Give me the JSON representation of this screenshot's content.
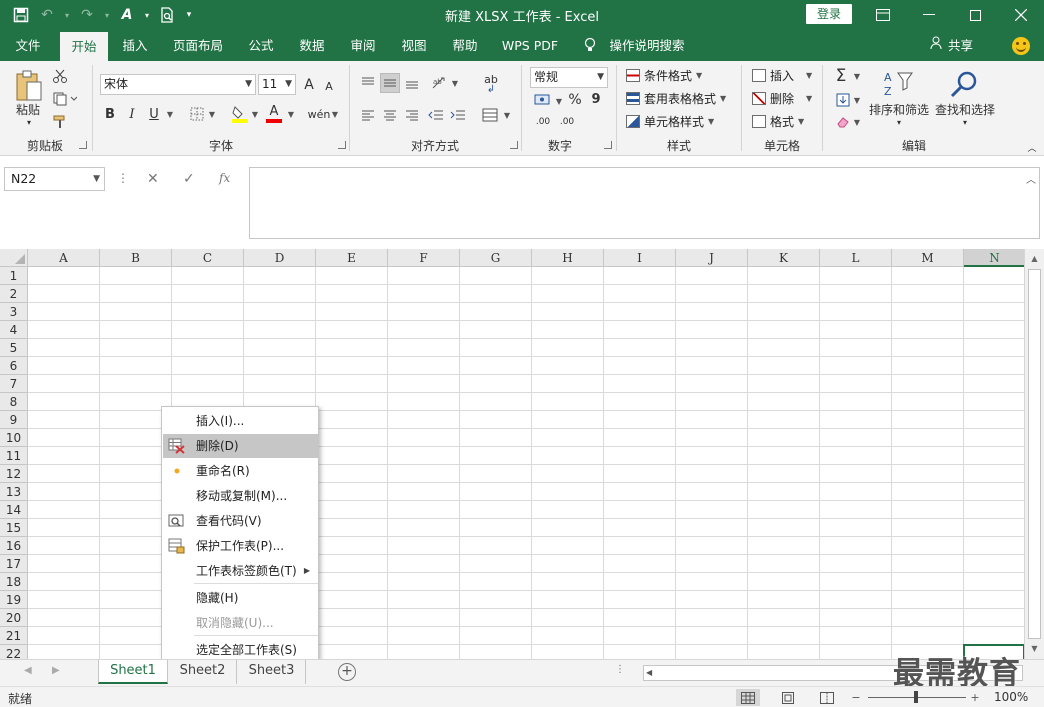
{
  "title": "新建 XLSX 工作表 - Excel",
  "login": "登录",
  "colors": {
    "brand": "#217346",
    "menu_hover": "#c6c6c6"
  },
  "tabs": [
    "文件",
    "开始",
    "插入",
    "页面布局",
    "公式",
    "数据",
    "审阅",
    "视图",
    "帮助",
    "WPS PDF",
    "操作说明搜索"
  ],
  "share": "共享",
  "ribbon": {
    "clipboard": {
      "paste": "粘贴",
      "label": "剪贴板"
    },
    "font": {
      "name": "宋体",
      "size": "11",
      "bold": "B",
      "italic": "I",
      "underline": "U",
      "grow": "A",
      "shrink": "A",
      "font_color": "A",
      "phonetic": "wén",
      "label": "字体"
    },
    "alignment": {
      "label": "对齐方式",
      "wrap": "ab"
    },
    "number": {
      "format": "常规",
      "percent": "%",
      "comma": "9",
      "inc": ".00",
      "dec": ".00",
      "label": "数字"
    },
    "styles": {
      "cond": "条件格式",
      "table": "套用表格格式",
      "cell": "单元格样式",
      "label": "样式"
    },
    "cells": {
      "insert": "插入",
      "delete": "删除",
      "format": "格式",
      "label": "单元格"
    },
    "editing": {
      "sort": "排序和筛选",
      "find": "查找和选择",
      "label": "编辑",
      "sigma": "Σ"
    }
  },
  "formula_bar": {
    "name_box": "N22",
    "fx": "fx",
    "value": ""
  },
  "columns": [
    "A",
    "B",
    "C",
    "D",
    "E",
    "F",
    "G",
    "H",
    "I",
    "J",
    "K",
    "L",
    "M",
    "N"
  ],
  "rows": [
    "1",
    "2",
    "3",
    "4",
    "5",
    "6",
    "7",
    "8",
    "9",
    "10",
    "11",
    "12",
    "13",
    "14",
    "15",
    "16",
    "17",
    "18",
    "19",
    "20",
    "21",
    "22"
  ],
  "selected_column": "N",
  "selected_cell": "N22",
  "context_menu": [
    {
      "label": "插入(I)...",
      "icon": "",
      "state": "normal"
    },
    {
      "label": "删除(D)",
      "icon": "delete-sheet-icon",
      "state": "hover"
    },
    {
      "label": "重命名(R)",
      "icon": "dot-icon",
      "state": "normal"
    },
    {
      "label": "移动或复制(M)...",
      "icon": "",
      "state": "normal"
    },
    {
      "label": "查看代码(V)",
      "icon": "view-code-icon",
      "state": "normal"
    },
    {
      "label": "保护工作表(P)...",
      "icon": "protect-sheet-icon",
      "state": "normal"
    },
    {
      "label": "工作表标签颜色(T)",
      "icon": "",
      "state": "normal",
      "submenu": true
    },
    {
      "label": "隐藏(H)",
      "icon": "",
      "state": "normal"
    },
    {
      "label": "取消隐藏(U)...",
      "icon": "",
      "state": "disabled"
    },
    {
      "label": "选定全部工作表(S)",
      "icon": "",
      "state": "normal"
    }
  ],
  "sheets": [
    "Sheet1",
    "Sheet2",
    "Sheet3"
  ],
  "active_sheet": "Sheet1",
  "status": {
    "ready": "就绪",
    "zoom": "100%",
    "zoom_minus": "−",
    "zoom_plus": "+"
  },
  "watermark": "最需教育"
}
